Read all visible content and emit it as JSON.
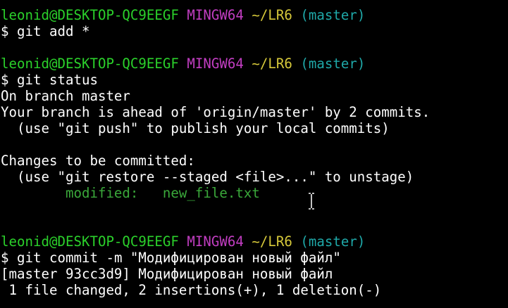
{
  "prompt": {
    "user_host": "leonid@DESKTOP-QC9EEGF",
    "shell": "MINGW64",
    "path": "~/LR6",
    "branch": "(master)",
    "symbol": "$ "
  },
  "commands": {
    "add": "git add *",
    "status": "git status",
    "commit": "git commit -m \"Модифицирован новый файл\""
  },
  "status_output": {
    "on_branch": "On branch master",
    "ahead": "Your branch is ahead of 'origin/master' by 2 commits.",
    "push_hint": "  (use \"git push\" to publish your local commits)",
    "changes_header": "Changes to be committed:",
    "restore_hint": "  (use \"git restore --staged <file>...\" to unstage)",
    "modified_label": "        modified:   ",
    "modified_file": "new_file.txt"
  },
  "commit_output": {
    "summary": "[master 93cc3d9] Модифицирован новый файл",
    "stats": " 1 file changed, 2 insertions(+), 1 deletion(-)"
  },
  "colors": {
    "background": "#000000",
    "text": "#ffffff",
    "user_host": "#2bd12b",
    "shell": "#c23ec2",
    "path": "#d6c83a",
    "branch": "#1fa9a9",
    "modified": "#3aa83a"
  },
  "cursor_icon": "text-ibeam-cursor-icon"
}
